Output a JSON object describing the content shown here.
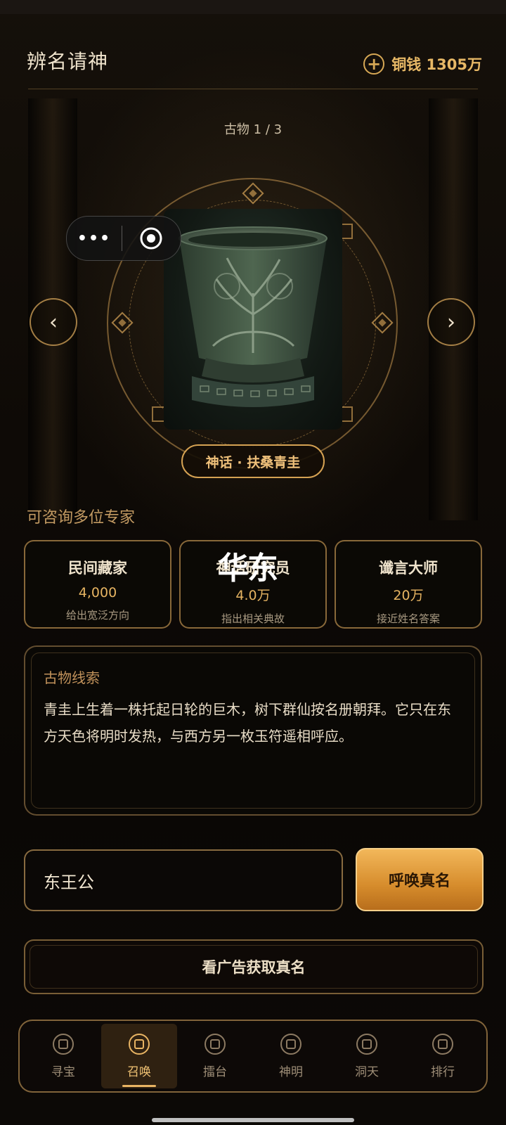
{
  "header": {
    "title": "辨名请神",
    "coins_label": "铜钱 1305万",
    "add_symbol": "+"
  },
  "artifact": {
    "counter": "古物 1 / 3",
    "name": "神话 · 扶桑青圭"
  },
  "capsule": {
    "more": "•••"
  },
  "nav": {
    "prev": "‹",
    "next": "›"
  },
  "experts": {
    "title": "可咨询多位专家",
    "items": [
      {
        "name": "民间藏家",
        "cost": "4,000",
        "desc": "给出宽泛方向"
      },
      {
        "name": "神话研究员",
        "cost": "4.0万",
        "desc": "指出相关典故"
      },
      {
        "name": "谶言大师",
        "cost": "20万",
        "desc": "接近姓名答案"
      }
    ],
    "overlay": "华东"
  },
  "clue": {
    "label": "古物线索",
    "text": "青圭上生着一株托起日轮的巨木，树下群仙按名册朝拜。它只在东方天色将明时发热，与西方另一枚玉符遥相呼应。"
  },
  "answer": {
    "value": "东王公"
  },
  "buttons": {
    "summon": "呼唤真名",
    "ad": "看广告获取真名"
  },
  "tabs": [
    {
      "label": "寻宝",
      "icon": "treasure-icon"
    },
    {
      "label": "召唤",
      "icon": "summon-icon",
      "active": true
    },
    {
      "label": "擂台",
      "icon": "arena-icon"
    },
    {
      "label": "神明",
      "icon": "deity-icon"
    },
    {
      "label": "洞天",
      "icon": "cave-icon"
    },
    {
      "label": "排行",
      "icon": "rank-icon"
    }
  ],
  "colors": {
    "accent": "#e8b463",
    "gold_button": "#d68c2c",
    "background": "#0b0805"
  }
}
